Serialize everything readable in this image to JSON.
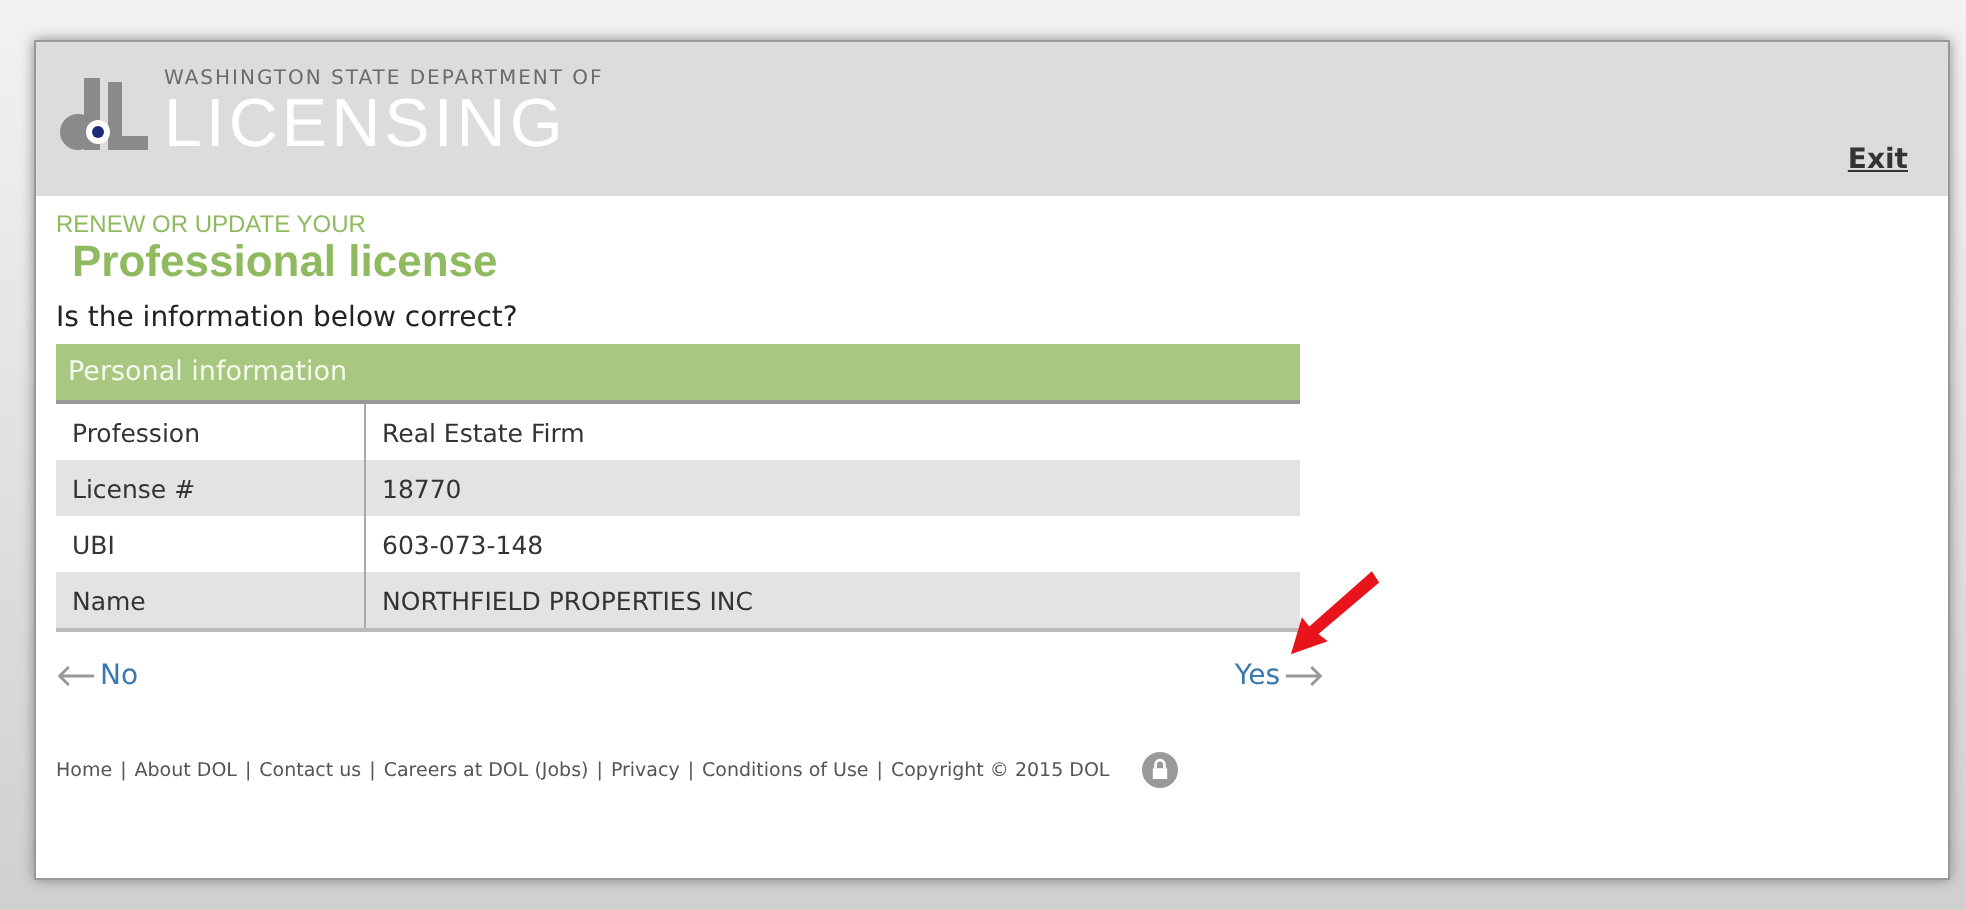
{
  "header": {
    "logo_top": "WASHINGTON STATE DEPARTMENT OF",
    "logo_main": "LICENSING",
    "exit": "Exit"
  },
  "heading": {
    "kicker": "RENEW OR UPDATE YOUR",
    "title": "Professional license"
  },
  "question": "Is the information below correct?",
  "table": {
    "title": "Personal information",
    "rows": [
      {
        "label": "Profession",
        "value": "Real Estate Firm"
      },
      {
        "label": "License #",
        "value": "18770"
      },
      {
        "label": "UBI",
        "value": "603-073-148"
      },
      {
        "label": "Name",
        "value": "NORTHFIELD PROPERTIES INC"
      }
    ]
  },
  "nav": {
    "back": "No",
    "forward": "Yes"
  },
  "footer": {
    "separator": "|",
    "links": [
      "Home",
      "About DOL",
      "Contact us",
      "Careers at DOL (Jobs)",
      "Privacy",
      "Conditions of Use"
    ],
    "copyright": "Copyright © 2015 DOL"
  }
}
